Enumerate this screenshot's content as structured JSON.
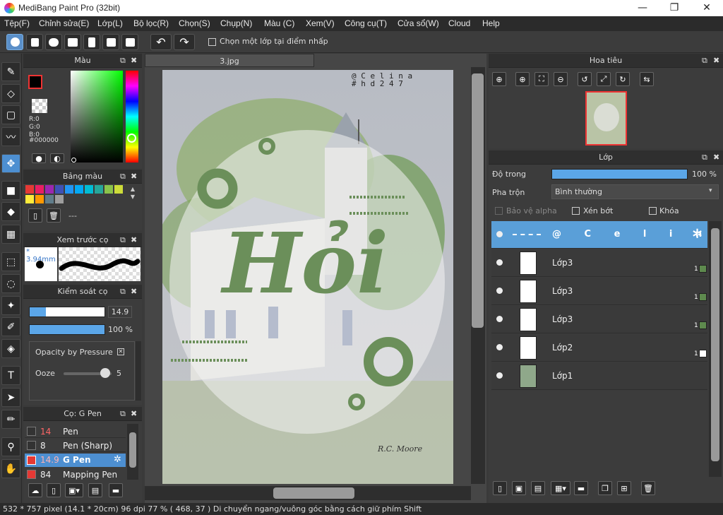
{
  "window": {
    "title": "MediBang Paint Pro (32bit)",
    "min": "—",
    "max": "❐",
    "close": "✕"
  },
  "menu": [
    "Tệp(F)",
    "Chỉnh sửa(E)",
    "Lớp(L)",
    "Bộ lọc(R)",
    "Chọn(S)",
    "Chụp(N)",
    "Màu (C)",
    "Xem(V)",
    "Công cụ(T)",
    "Cửa sổ(W)",
    "Cloud",
    "Help"
  ],
  "toolbar": {
    "select_layer_label": "Chọn một lớp tại điểm nhấp"
  },
  "color_panel": {
    "title": "Màu",
    "r": "R:0",
    "g": "G:0",
    "b": "B:0",
    "hex": "#000000"
  },
  "palette_panel": {
    "title": "Bảng màu",
    "name": "---",
    "swatches": [
      "#e53935",
      "#e91e63",
      "#9c27b0",
      "#3f51b5",
      "#2196f3",
      "#03a9f4",
      "#00bcd4",
      "#26a69a",
      "#8bc34a",
      "#cddc39",
      "#ffeb3b",
      "#ff9800",
      "#607d8b",
      "#9e9e9e"
    ]
  },
  "preview_panel": {
    "title": "Xem trước cọ",
    "size": "* 3.94mm"
  },
  "brush_ctrl": {
    "title": "Kiểm soát cọ",
    "size": "14.9",
    "opacity": "100 %",
    "opt1": "Opacity by Pressure",
    "opt2": "Ooze",
    "opt2_val": "5",
    "size_fill": 0.22,
    "opacity_fill": 1.0
  },
  "brush_list": {
    "title": "Cọ: G Pen",
    "items": [
      {
        "size": "14",
        "name": "Pen",
        "color": "#333333",
        "selected": false
      },
      {
        "size": "8",
        "name": "Pen (Sharp)",
        "color": "#333333",
        "selected": false
      },
      {
        "size": "14.9",
        "name": "G Pen",
        "color": "#e53935",
        "selected": true
      },
      {
        "size": "84",
        "name": "Mapping Pen",
        "color": "#e53935",
        "selected": false
      }
    ]
  },
  "canvas": {
    "tab": "3.jpg",
    "watermark1": "@ C e l i n a",
    "watermark2": "# h d 2 4 7",
    "lettering": "Hỏi",
    "signature": "R.C. Moore"
  },
  "navigator": {
    "title": "Hoa tiêu"
  },
  "layers": {
    "title": "Lớp",
    "opacity_label": "Độ trong",
    "opacity_value": "100 %",
    "opacity_fill": 1.0,
    "blend_label": "Pha trộn",
    "blend_value": "Bình thường",
    "protect_alpha": "Bảo vệ alpha",
    "clipping": "Xén bớt",
    "lock": "Khóa",
    "items": [
      {
        "name": "@ C e l i n a",
        "selected": true,
        "num": "",
        "swatch": ""
      },
      {
        "name": "Lớp3",
        "selected": false,
        "num": "1",
        "swatch": "#5e8a4e"
      },
      {
        "name": "Lớp3",
        "selected": false,
        "num": "1",
        "swatch": "#5e8a4e"
      },
      {
        "name": "Lớp3",
        "selected": false,
        "num": "1",
        "swatch": "#5e8a4e"
      },
      {
        "name": "Lớp2",
        "selected": false,
        "num": "1",
        "swatch": "#ffffff"
      },
      {
        "name": "Lớp1",
        "selected": false,
        "num": "",
        "swatch": ""
      }
    ]
  },
  "status": "532 * 757 pixel  (14.1 * 20cm)  96 dpi  77 %  ( 468, 37 )  Di chuyển ngang/vuông góc bằng cách giữ phím Shift"
}
